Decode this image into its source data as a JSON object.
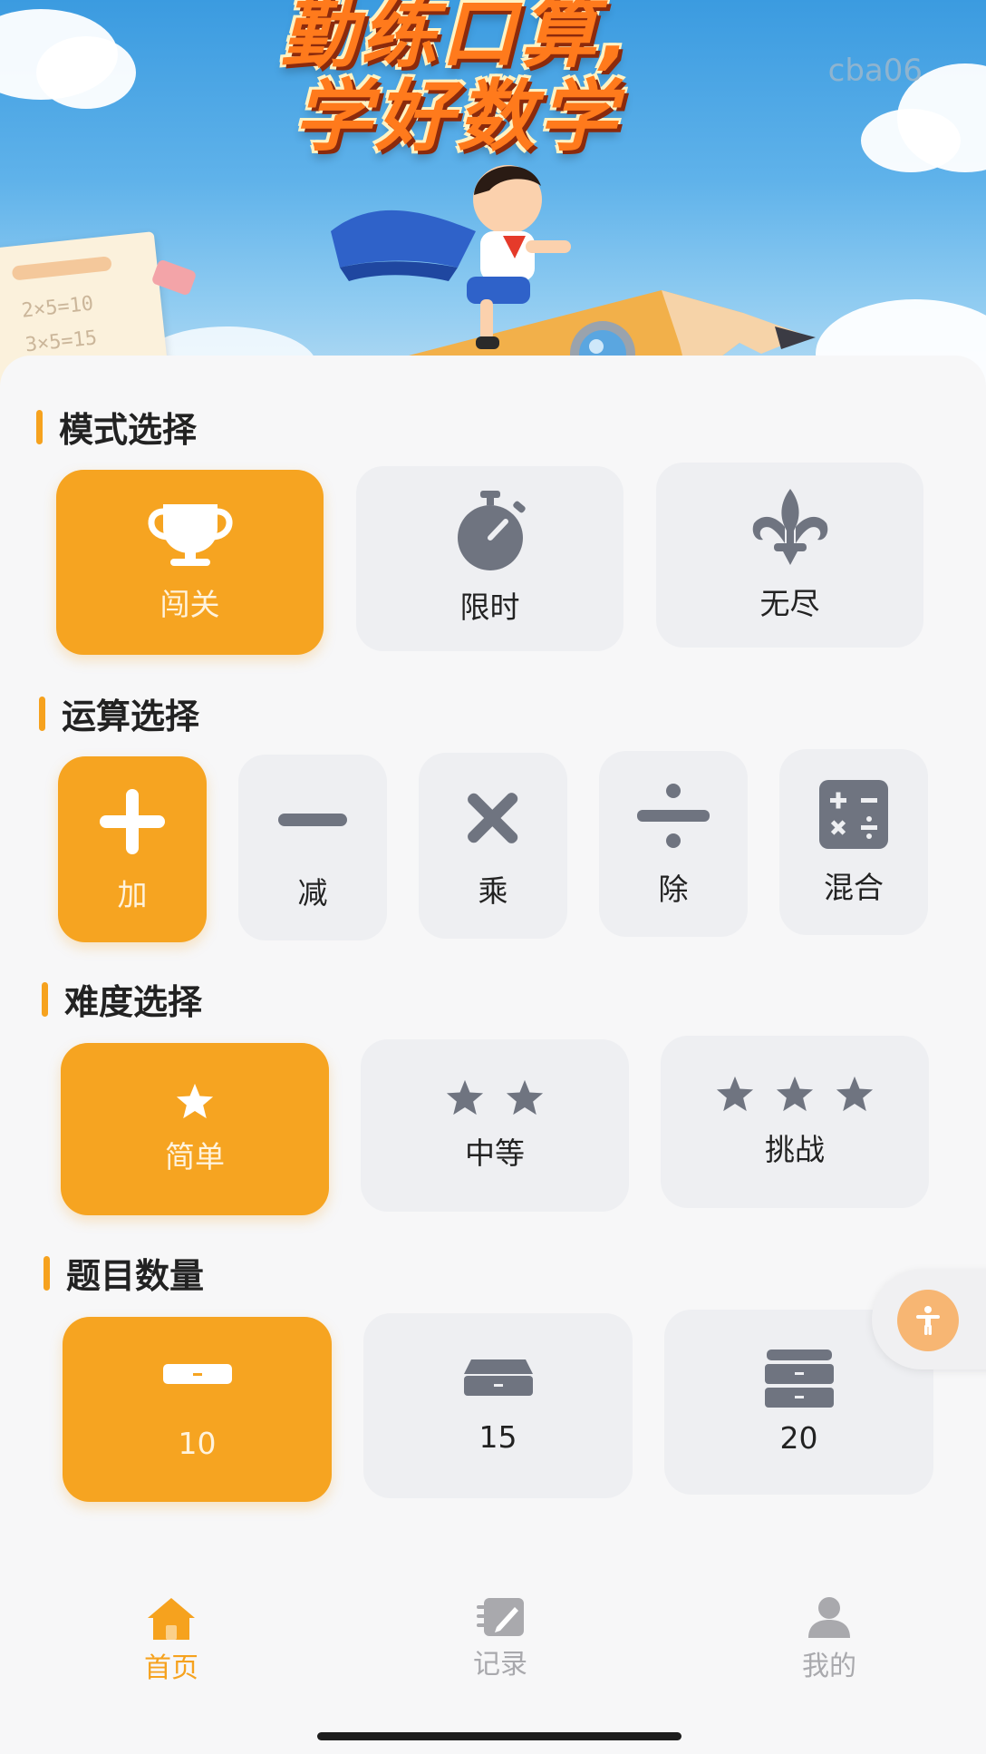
{
  "banner": {
    "title_line1": "勤练口算,",
    "title_line2": "学好数学",
    "watermark": "cba06",
    "paper_lines": [
      "2×5=10",
      "3×5=15"
    ]
  },
  "sections": {
    "mode": {
      "title": "模式选择",
      "options": [
        {
          "label": "闯关",
          "icon": "trophy-icon",
          "selected": true
        },
        {
          "label": "限时",
          "icon": "stopwatch-icon",
          "selected": false
        },
        {
          "label": "无尽",
          "icon": "fleur-de-lis-icon",
          "selected": false
        }
      ]
    },
    "operation": {
      "title": "运算选择",
      "options": [
        {
          "label": "加",
          "icon": "plus-icon",
          "selected": true
        },
        {
          "label": "减",
          "icon": "minus-icon",
          "selected": false
        },
        {
          "label": "乘",
          "icon": "multiply-icon",
          "selected": false
        },
        {
          "label": "除",
          "icon": "divide-icon",
          "selected": false
        },
        {
          "label": "混合",
          "icon": "calculator-icon",
          "selected": false
        }
      ]
    },
    "difficulty": {
      "title": "难度选择",
      "options": [
        {
          "label": "简单",
          "stars": 1,
          "selected": true
        },
        {
          "label": "中等",
          "stars": 2,
          "selected": false
        },
        {
          "label": "挑战",
          "stars": 3,
          "selected": false
        }
      ]
    },
    "count": {
      "title": "题目数量",
      "options": [
        {
          "label": "10",
          "icon": "drawer-one-icon",
          "selected": true
        },
        {
          "label": "15",
          "icon": "drawer-two-icon",
          "selected": false
        },
        {
          "label": "20",
          "icon": "drawer-stack-icon",
          "selected": false
        }
      ]
    }
  },
  "nav": {
    "items": [
      {
        "label": "首页",
        "icon": "home-icon",
        "active": true
      },
      {
        "label": "记录",
        "icon": "record-icon",
        "active": false
      },
      {
        "label": "我的",
        "icon": "user-icon",
        "active": false
      }
    ]
  },
  "colors": {
    "accent": "#f6a421",
    "option_bg": "#eeeff2",
    "icon_gray": "#6f7480",
    "nav_inactive": "#a9a9ad"
  }
}
